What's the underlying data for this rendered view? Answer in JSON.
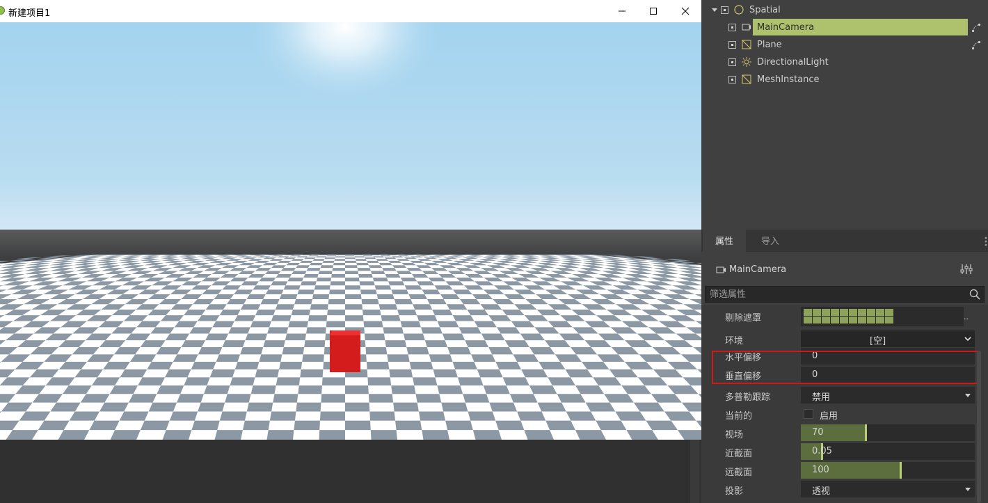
{
  "window": {
    "title": "新建项目1"
  },
  "scene_tree": {
    "root": "Spatial",
    "nodes": [
      {
        "label": "MainCamera",
        "icon": "camera-icon",
        "selected": true,
        "signal": true
      },
      {
        "label": "Plane",
        "icon": "mesh-icon",
        "selected": false,
        "signal": true
      },
      {
        "label": "DirectionalLight",
        "icon": "light-icon",
        "selected": false,
        "signal": false
      },
      {
        "label": "MeshInstance",
        "icon": "mesh-icon",
        "selected": false,
        "signal": false
      }
    ],
    "selection_color": "#aec26e"
  },
  "inspector": {
    "tabs": [
      {
        "label": "属性",
        "active": true
      },
      {
        "label": "导入",
        "active": false
      }
    ],
    "object_name": "MainCamera",
    "filter_placeholder": "筛选属性",
    "properties": {
      "cull_mask": {
        "label": "剔除遮罩",
        "more": ".."
      },
      "environment": {
        "label": "环境",
        "value": "[空]"
      },
      "h_offset": {
        "label": "水平偏移",
        "value": "0"
      },
      "v_offset": {
        "label": "垂直偏移",
        "value": "0"
      },
      "doppler": {
        "label": "多普勒跟踪",
        "value": "禁用"
      },
      "current": {
        "label": "当前的",
        "value": "启用",
        "checked": false
      },
      "fov": {
        "label": "视场",
        "value": "70",
        "fill": 0.37
      },
      "near": {
        "label": "近截面",
        "value": "0.05",
        "fill": 0.12
      },
      "far": {
        "label": "远截面",
        "value": "100",
        "fill": 0.57
      },
      "projection": {
        "label": "投影",
        "value": "透视"
      }
    },
    "highlight_color": "#d01818"
  }
}
